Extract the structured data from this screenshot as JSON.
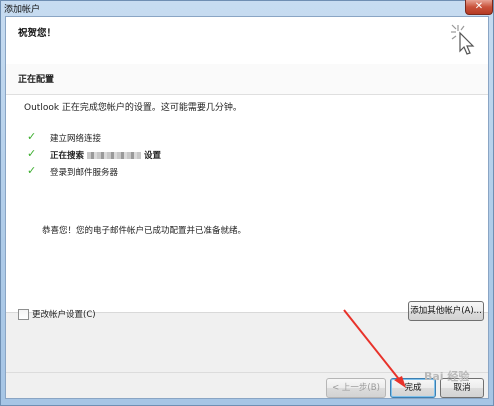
{
  "window": {
    "title": "添加帐户"
  },
  "header": {
    "heading": "祝贺您！"
  },
  "section": {
    "title": "正在配置"
  },
  "intro": "Outlook 正在完成您帐户的设置。这可能需要几分钟。",
  "steps": [
    {
      "label": "建立网络连接"
    },
    {
      "label_prefix": "正在搜索",
      "label_suffix": "设置"
    },
    {
      "label": "登录到邮件服务器"
    }
  ],
  "congrats": "恭喜您！您的电子邮件帐户已成功配置并已准备就绪。",
  "options": {
    "change_settings": "更改帐户设置(C)"
  },
  "buttons": {
    "add_other": "添加其他帐户(A)...",
    "back": "< 上一步(B)",
    "finish": "完成",
    "cancel": "取消"
  },
  "watermark": "Bai 经验",
  "colors": {
    "check": "#3cae2e",
    "arrow": "#e8322a"
  }
}
